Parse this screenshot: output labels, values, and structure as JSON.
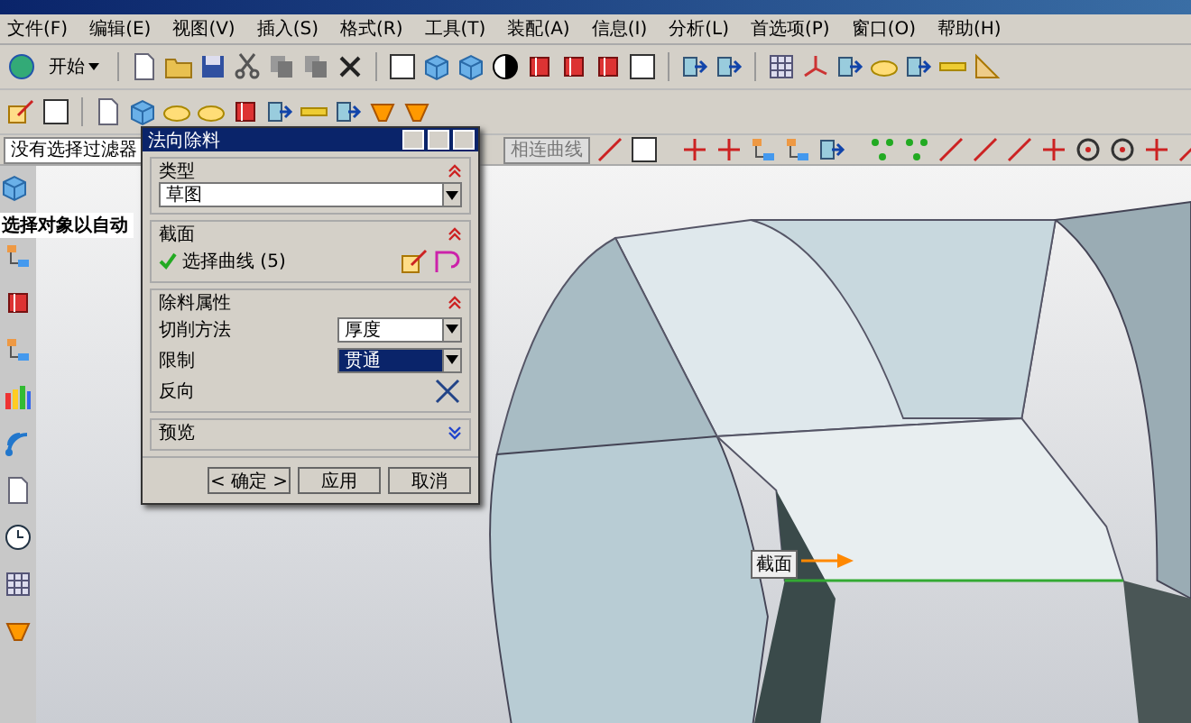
{
  "menu": [
    "文件(F)",
    "编辑(E)",
    "视图(V)",
    "插入(S)",
    "格式(R)",
    "工具(T)",
    "装配(A)",
    "信息(I)",
    "分析(L)",
    "首选项(P)",
    "窗口(O)",
    "帮助(H)"
  ],
  "toolbar": {
    "start_button": "开始"
  },
  "selection_bar": {
    "filter": "没有选择过滤器",
    "curve_rule": "相连曲线"
  },
  "side_panel": {
    "hint": "选择对象以自动"
  },
  "dialog": {
    "title": "法向除料",
    "sections": [
      {
        "title": "类型",
        "expanded": true,
        "kind": "dropdown",
        "value": "草图"
      },
      {
        "title": "截面",
        "expanded": true,
        "kind": "selection",
        "label": "选择曲线 (5)",
        "checked": true
      },
      {
        "title": "除料属性",
        "expanded": true,
        "kind": "properties",
        "rows": [
          {
            "label": "切削方法",
            "kind": "dropdown",
            "value": "厚度",
            "selected": false
          },
          {
            "label": "限制",
            "kind": "dropdown",
            "value": "贯通",
            "selected": true
          },
          {
            "label": "反向",
            "kind": "button"
          }
        ]
      },
      {
        "title": "预览",
        "expanded": false
      }
    ],
    "buttons": [
      "< 确定 >",
      "应用",
      "取消"
    ]
  },
  "viewport": {
    "section_label": "截面"
  }
}
